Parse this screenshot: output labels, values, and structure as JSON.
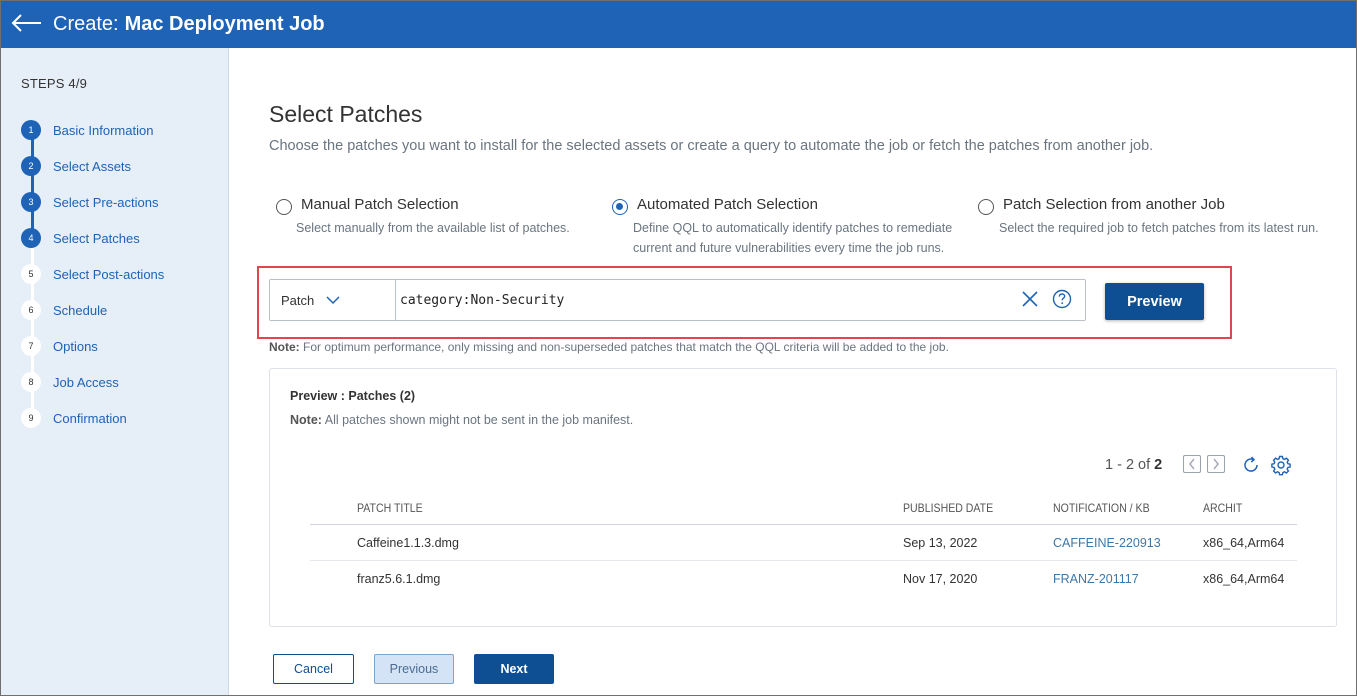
{
  "header": {
    "prefix": "Create:",
    "title": "Mac Deployment Job"
  },
  "sidebar": {
    "steps_label": "STEPS 4/9",
    "steps": [
      {
        "number": "1",
        "label": "Basic Information",
        "done": true
      },
      {
        "number": "2",
        "label": "Select Assets",
        "done": true
      },
      {
        "number": "3",
        "label": "Select Pre-actions",
        "done": true
      },
      {
        "number": "4",
        "label": "Select Patches",
        "done": true
      },
      {
        "number": "5",
        "label": "Select Post-actions",
        "done": false
      },
      {
        "number": "6",
        "label": "Schedule",
        "done": false
      },
      {
        "number": "7",
        "label": "Options",
        "done": false
      },
      {
        "number": "8",
        "label": "Job Access",
        "done": false
      },
      {
        "number": "9",
        "label": "Confirmation",
        "done": false
      }
    ]
  },
  "main": {
    "title": "Select Patches",
    "subtitle": "Choose the patches you want to install for the selected assets or create a query to automate the job or fetch the patches from another job.",
    "options": [
      {
        "label": "Manual Patch Selection",
        "desc_line1": "Select manually from the available list of patches.",
        "desc_line2": "",
        "checked": false
      },
      {
        "label": "Automated Patch Selection",
        "desc_line1": "Define QQL to automatically identify patches to remediate",
        "desc_line2": "current and future vulnerabilities every time the job runs.",
        "checked": true
      },
      {
        "label": "Patch Selection from another Job",
        "desc_line1": "Select the required job to fetch patches from its latest run.",
        "desc_line2": "",
        "checked": false
      }
    ],
    "query": {
      "type": "Patch",
      "value": "category:Non-Security",
      "preview_label": "Preview"
    },
    "note_label": "Note:",
    "note_text": " For optimum performance, only missing and non-superseded patches that match the QQL criteria will be added to the job."
  },
  "preview": {
    "title": "Preview : Patches (2)",
    "note_label": "Note:",
    "note_text": " All patches shown might not be sent in the job manifest.",
    "pager_range": "1 - 2 of ",
    "pager_total": "2",
    "columns": [
      "PATCH TITLE",
      "PUBLISHED DATE",
      "NOTIFICATION / KB",
      "ARCHIT"
    ],
    "rows": [
      {
        "title": "Caffeine1.1.3.dmg",
        "date": "Sep 13, 2022",
        "kb": "CAFFEINE-220913",
        "arch": "x86_64,Arm64"
      },
      {
        "title": "franz5.6.1.dmg",
        "date": "Nov 17, 2020",
        "kb": "FRANZ-201117",
        "arch": "x86_64,Arm64"
      }
    ]
  },
  "footer": {
    "cancel": "Cancel",
    "previous": "Previous",
    "next": "Next"
  },
  "colors": {
    "brand": "#1e63b5",
    "primary_button": "#0e4f94",
    "highlight": "#e0474c",
    "sidebar_bg": "#e6eef8"
  }
}
